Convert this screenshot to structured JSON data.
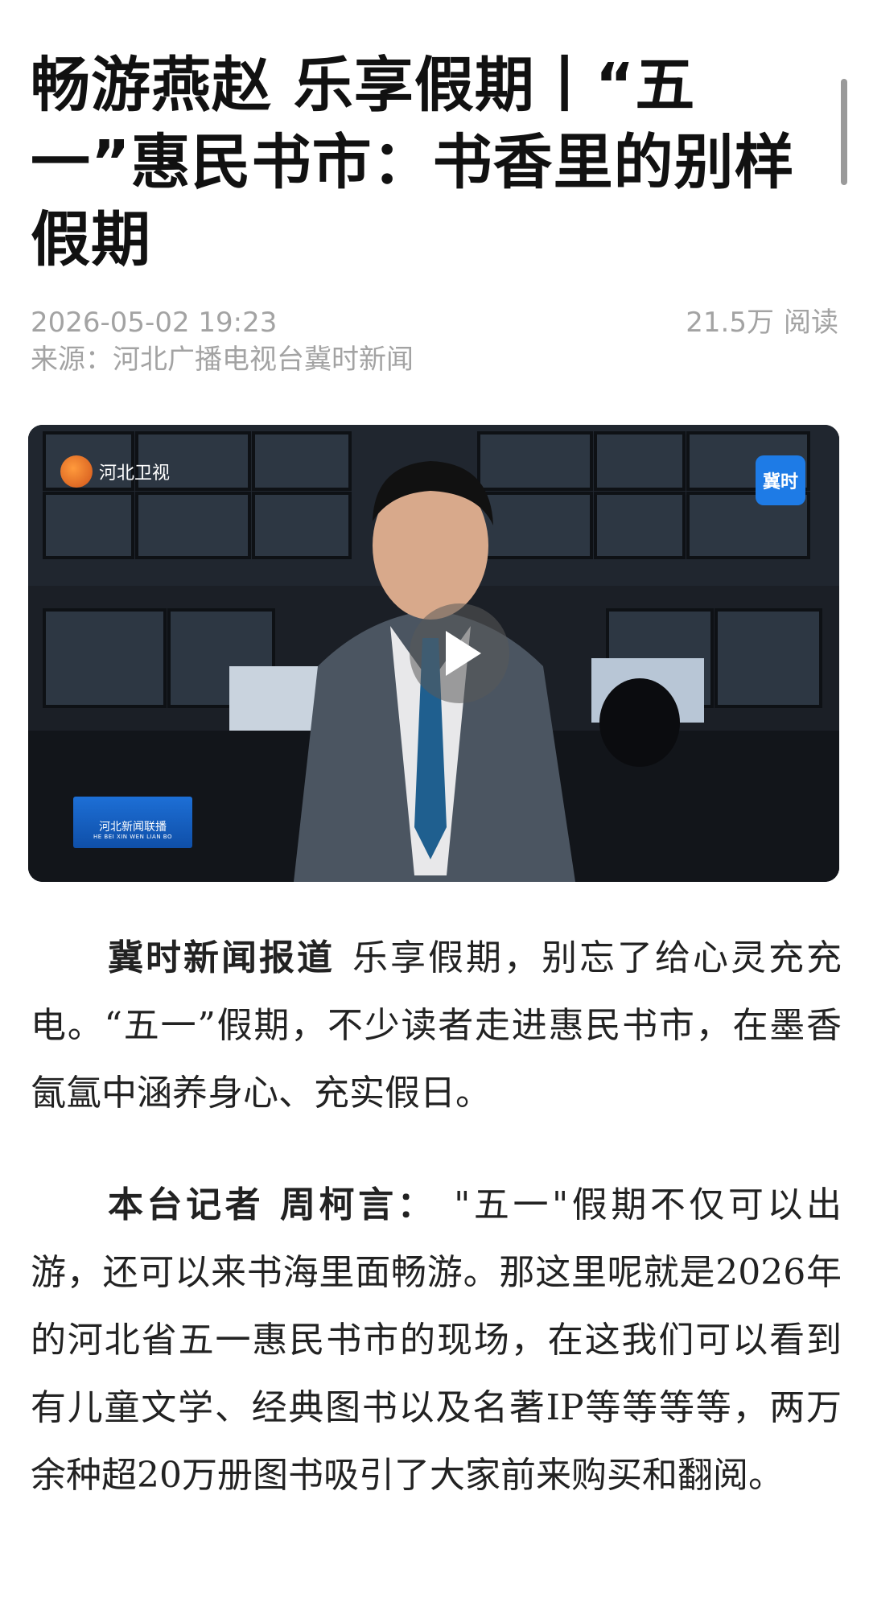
{
  "article": {
    "title": "畅游燕赵  乐享假期丨“五一”惠民书市：书香里的别样假期",
    "date": "2026-05-02  19:23",
    "reads_count": "21.5万",
    "reads_label": "阅读",
    "source": "来源：河北广播电视台冀时新闻"
  },
  "video": {
    "logo_hebei": "河北卫视",
    "logo_jishi": "冀时",
    "logo_news": "河北新闻联播",
    "logo_news_sub": "HE BEI XIN WEN LIAN BO",
    "play_icon": "play-icon"
  },
  "paragraphs": [
    {
      "lead": "冀时新闻报道",
      "text": "乐享假期，别忘了给心灵充充电。“五一”假期，不少读者走进惠民书市，在墨香氤氲中涵养身心、充实假日。"
    },
    {
      "lead": "本台记者  周柯言：",
      "text": "\"五一\"假期不仅可以出游，还可以来书海里面畅游。那这里呢就是2026年的河北省五一惠民书市的现场，在这我们可以看到有儿童文学、经典图书以及名著IP等等等等，两万余种超20万册图书吸引了大家前来购买和翻阅。"
    }
  ],
  "colors": {
    "title": "#111111",
    "meta": "#a3a3a3",
    "body": "#222222",
    "scrollbar": "#9a9a9a"
  }
}
